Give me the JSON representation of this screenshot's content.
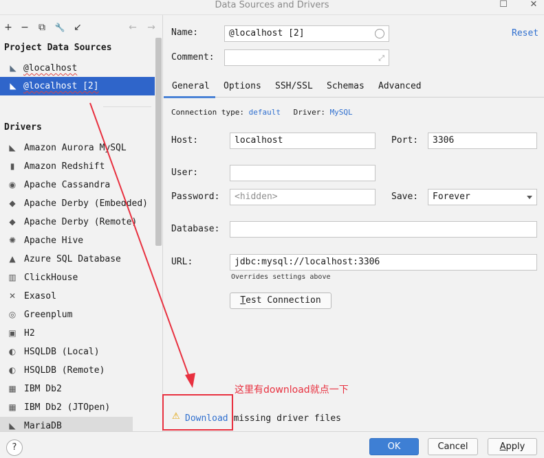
{
  "window": {
    "title": "Data Sources and Drivers",
    "maximize_glyph": "☐",
    "close_glyph": "✕"
  },
  "toolbar": {
    "add": "+",
    "remove": "−",
    "duplicate": "⧉",
    "wrench": "🔧",
    "import": "↙",
    "back": "←",
    "forward": "→"
  },
  "project": {
    "heading": "Project Data Sources",
    "items": [
      {
        "label": "@localhost",
        "selected": false
      },
      {
        "label": "@localhost [2]",
        "selected": true
      }
    ]
  },
  "drivers": {
    "heading": "Drivers",
    "items": [
      {
        "label": "Amazon Aurora MySQL",
        "icon": "dolphin-icon",
        "glyph": "◣"
      },
      {
        "label": "Amazon Redshift",
        "icon": "redshift-icon",
        "glyph": "▮"
      },
      {
        "label": "Apache Cassandra",
        "icon": "eye-icon",
        "glyph": "◉"
      },
      {
        "label": "Apache Derby (Embedded)",
        "icon": "derby-hat-icon",
        "glyph": "◆"
      },
      {
        "label": "Apache Derby (Remote)",
        "icon": "derby-hat-icon",
        "glyph": "◆"
      },
      {
        "label": "Apache Hive",
        "icon": "hive-icon",
        "glyph": "✺"
      },
      {
        "label": "Azure SQL Database",
        "icon": "azure-icon",
        "glyph": "▲"
      },
      {
        "label": "ClickHouse",
        "icon": "clickhouse-icon",
        "glyph": "▥"
      },
      {
        "label": "Exasol",
        "icon": "exasol-icon",
        "glyph": "✕"
      },
      {
        "label": "Greenplum",
        "icon": "greenplum-icon",
        "glyph": "◎"
      },
      {
        "label": "H2",
        "icon": "h2-icon",
        "glyph": "▣"
      },
      {
        "label": "HSQLDB (Local)",
        "icon": "hsqldb-icon",
        "glyph": "◐"
      },
      {
        "label": "HSQLDB (Remote)",
        "icon": "hsqldb-icon",
        "glyph": "◐"
      },
      {
        "label": "IBM Db2",
        "icon": "ibm-db2-icon",
        "glyph": "▦"
      },
      {
        "label": "IBM Db2 (JTOpen)",
        "icon": "ibm-db2-icon",
        "glyph": "▦"
      },
      {
        "label": "MariaDB",
        "icon": "mariadb-icon",
        "glyph": "◣"
      }
    ]
  },
  "form": {
    "name_label": "Name:",
    "name_value": "@localhost [2]",
    "reset_label": "Reset",
    "comment_label": "Comment:",
    "comment_value": "",
    "tabs": [
      "General",
      "Options",
      "SSH/SSL",
      "Schemas",
      "Advanced"
    ],
    "active_tab": "General",
    "connection_type_label": "Connection type:",
    "connection_type_value": "default",
    "driver_label": "Driver:",
    "driver_value": "MySQL",
    "host_label": "Host:",
    "host_value": "localhost",
    "port_label": "Port:",
    "port_value": "3306",
    "user_label": "User:",
    "user_value": "",
    "password_label": "Password:",
    "password_placeholder": "<hidden>",
    "save_label": "Save:",
    "save_value": "Forever",
    "database_label": "Database:",
    "database_value": "",
    "url_label": "URL:",
    "url_value": "jdbc:mysql://localhost:3306",
    "url_hint": "Overrides settings above",
    "test_first": "T",
    "test_rest": "est Connection"
  },
  "warning": {
    "icon_glyph": "⚠",
    "link": "Download",
    "text": "missing driver files"
  },
  "footer": {
    "help": "?",
    "ok": "OK",
    "cancel": "Cancel",
    "apply_first": "A",
    "apply_rest": "pply"
  },
  "annotation": {
    "text": "这里有download就点一下",
    "color": "#e8303f"
  }
}
